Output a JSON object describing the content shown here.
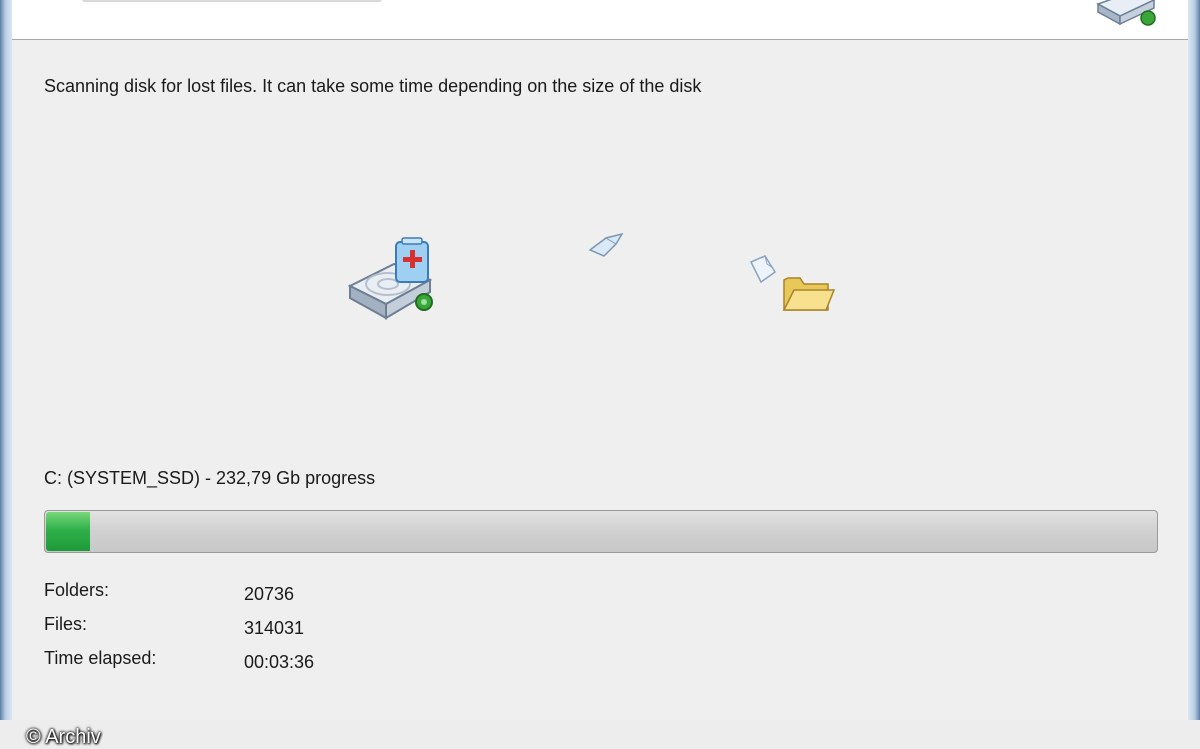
{
  "wizard": {
    "instruction": "Scanning disk for lost files. It can take some time depending on the size of the disk",
    "progress": {
      "label": "C: (SYSTEM_SSD) - 232,79 Gb progress",
      "fraction": 0.04
    },
    "stats": [
      {
        "label": "Folders:",
        "value": "20736"
      },
      {
        "label": "Files:",
        "value": "314031"
      },
      {
        "label": "Time elapsed:",
        "value": "00:03:36"
      }
    ]
  },
  "icons": {
    "header": "disk-recovery-icon",
    "source": "disk-recovery-icon",
    "flying": "document-icon",
    "small": "document-icon",
    "target": "folder-icon"
  },
  "colors": {
    "progress_fill": "#2fb04a",
    "background": "#efefef"
  },
  "watermark": "© Archiv"
}
